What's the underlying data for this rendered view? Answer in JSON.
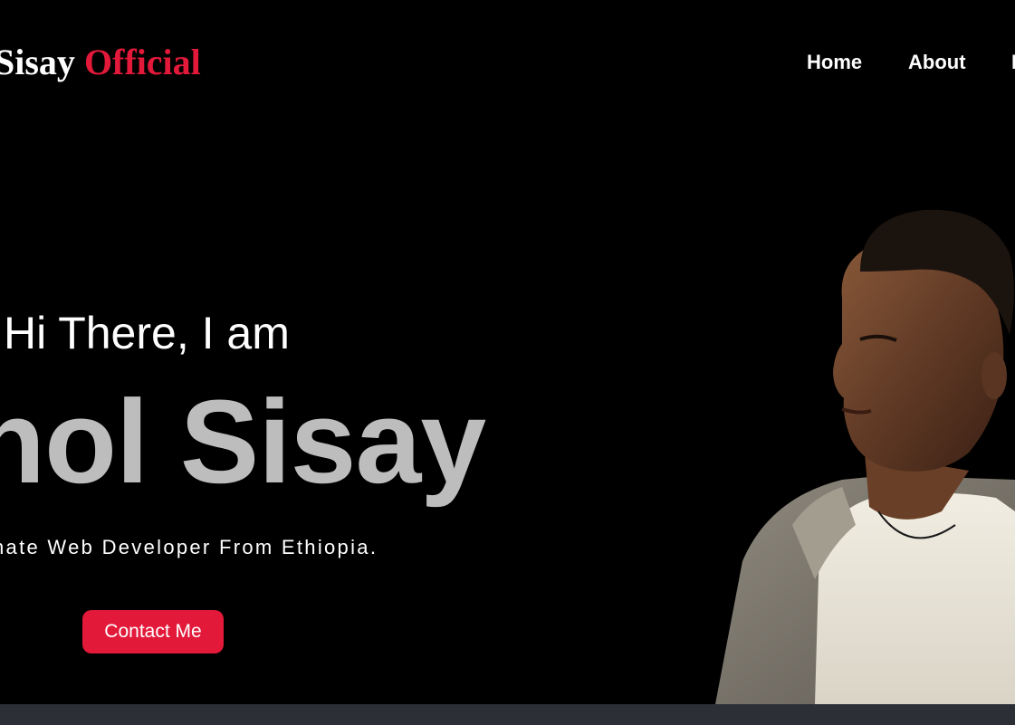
{
  "header": {
    "logo_main": "Sisay",
    "logo_accent": "Official",
    "nav": {
      "home": "Home",
      "about": "About",
      "partial": "I"
    }
  },
  "hero": {
    "greeting": "Hi There, I am",
    "name": "hol Sisay",
    "tagline": "nate Web Developer From Ethiopia.",
    "cta_label": "Contact Me"
  },
  "colors": {
    "background": "#000000",
    "accent": "#e3193a",
    "name_gray": "#bdbdbd",
    "footer_bar": "#2c2f36"
  },
  "icons": {
    "portrait": "person-portrait-photo"
  }
}
